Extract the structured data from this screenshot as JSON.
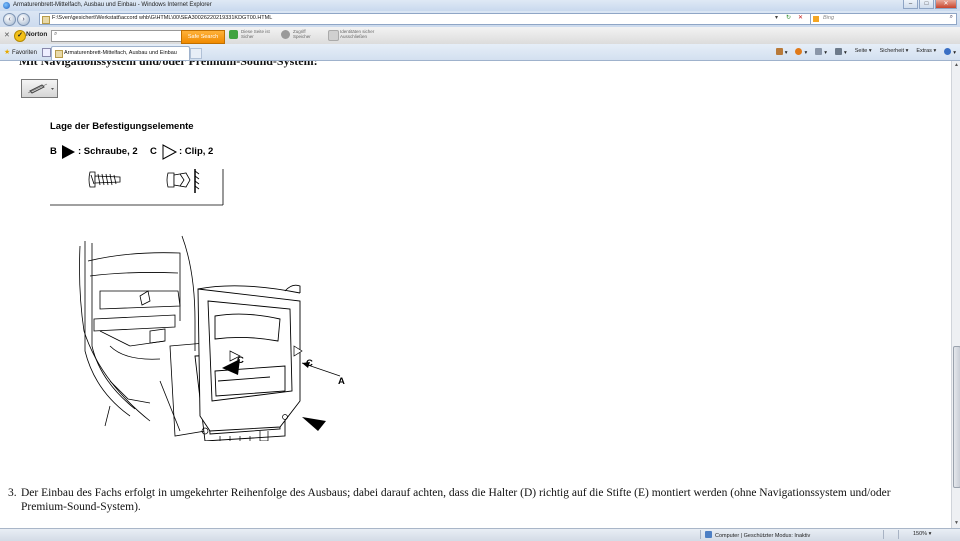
{
  "window": {
    "title": "Armaturenbrett-Mittelfach, Ausbau und Einbau - Windows Internet Explorer",
    "controls": [
      "minimize",
      "maximize",
      "close"
    ]
  },
  "address_bar": {
    "url": "F:\\Sven\\gesichert\\Werkstatt\\accord whb\\G\\HTML\\00\\SEA30026220219331KDGT00.HTML",
    "search_placeholder": "Bing",
    "search_icon": "magnifier-icon"
  },
  "norton_toolbar": {
    "brand": "Norton",
    "search_value": "",
    "safe_search_label": "Safe Search",
    "items": [
      {
        "line1": "Diese Seite ist",
        "line2": "Sicher",
        "color": "#3fa33f"
      },
      {
        "line1": "Zugriff",
        "line2": "Speicher",
        "color": "#9a9a9a"
      },
      {
        "line1": "Identitäten sicher",
        "line2": "Ausschließen",
        "color": "#d0d0d0"
      }
    ]
  },
  "tabs": {
    "favorites_label": "Favoriten",
    "active_tab": "Armaturenbrett-Mittelfach, Ausbau und Einbau",
    "commands": [
      "Seite ▾",
      "Sicherheit ▾",
      "Extras ▾"
    ]
  },
  "content": {
    "cut_heading": "Mit Navigationssystem und/oder Premium-Sound-System:",
    "diagram": {
      "legend_title": "Lage der Befestigungselemente",
      "legend_b": "B",
      "legend_b_text": ": Schraube, 2",
      "legend_c": "C",
      "legend_c_text": ": Clip, 2",
      "callouts": {
        "c1": "C",
        "c2": "C",
        "a": "A",
        "b1": "B",
        "b2": "B"
      }
    },
    "step": {
      "number": "3.",
      "text": "Der Einbau des Fachs erfolgt in umgekehrter Reihenfolge des Ausbaus; dabei darauf achten, dass die Halter (D) richtig auf die Stifte (E) montiert werden (ohne Navigationssystem und/oder Premium-Sound-System)."
    }
  },
  "status_bar": {
    "zone": "Computer | Geschützter Modus: Inaktiv",
    "zoom": "150%"
  }
}
